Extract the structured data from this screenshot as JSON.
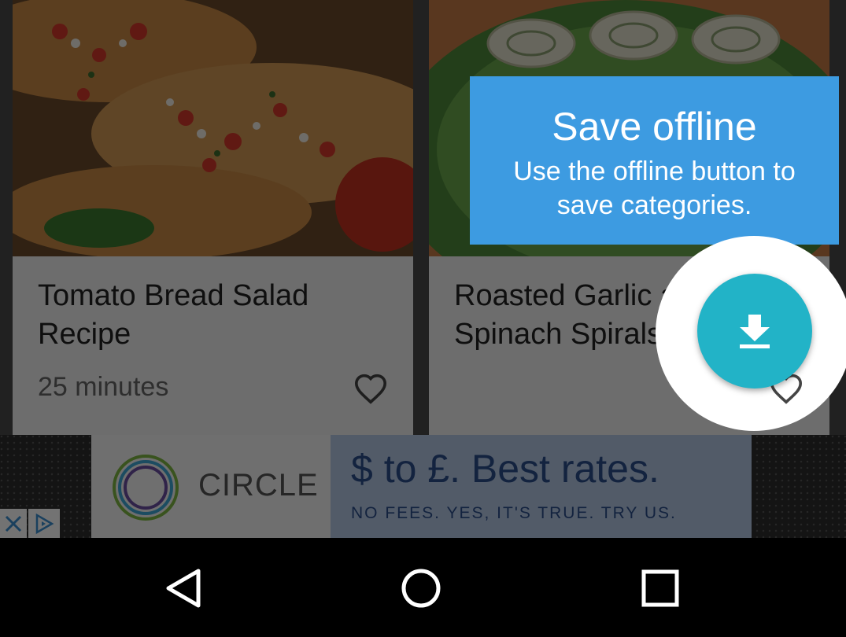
{
  "cards": [
    {
      "title": "Tomato Bread Salad Recipe",
      "meta": "25 minutes",
      "fav_icon": "heart-outline-icon"
    },
    {
      "title": "Roasted Garlic and Spinach Spirals",
      "meta": "",
      "fav_icon": "heart-outline-icon"
    }
  ],
  "tooltip": {
    "title": "Save offline",
    "body": "Use the offline button to save categories.",
    "color": "#3d9be1"
  },
  "fab": {
    "icon": "download-icon",
    "color": "#22b3c7"
  },
  "ad": {
    "brand": "CIRCLE",
    "headline": "$ to £. Best rates.",
    "subline": "NO FEES. YES, IT'S TRUE. TRY US.",
    "close_icon": "close-icon",
    "adchoices_icon": "adchoices-icon"
  },
  "navbar": {
    "back_icon": "back-icon",
    "home_icon": "home-icon",
    "recents_icon": "recents-icon"
  }
}
